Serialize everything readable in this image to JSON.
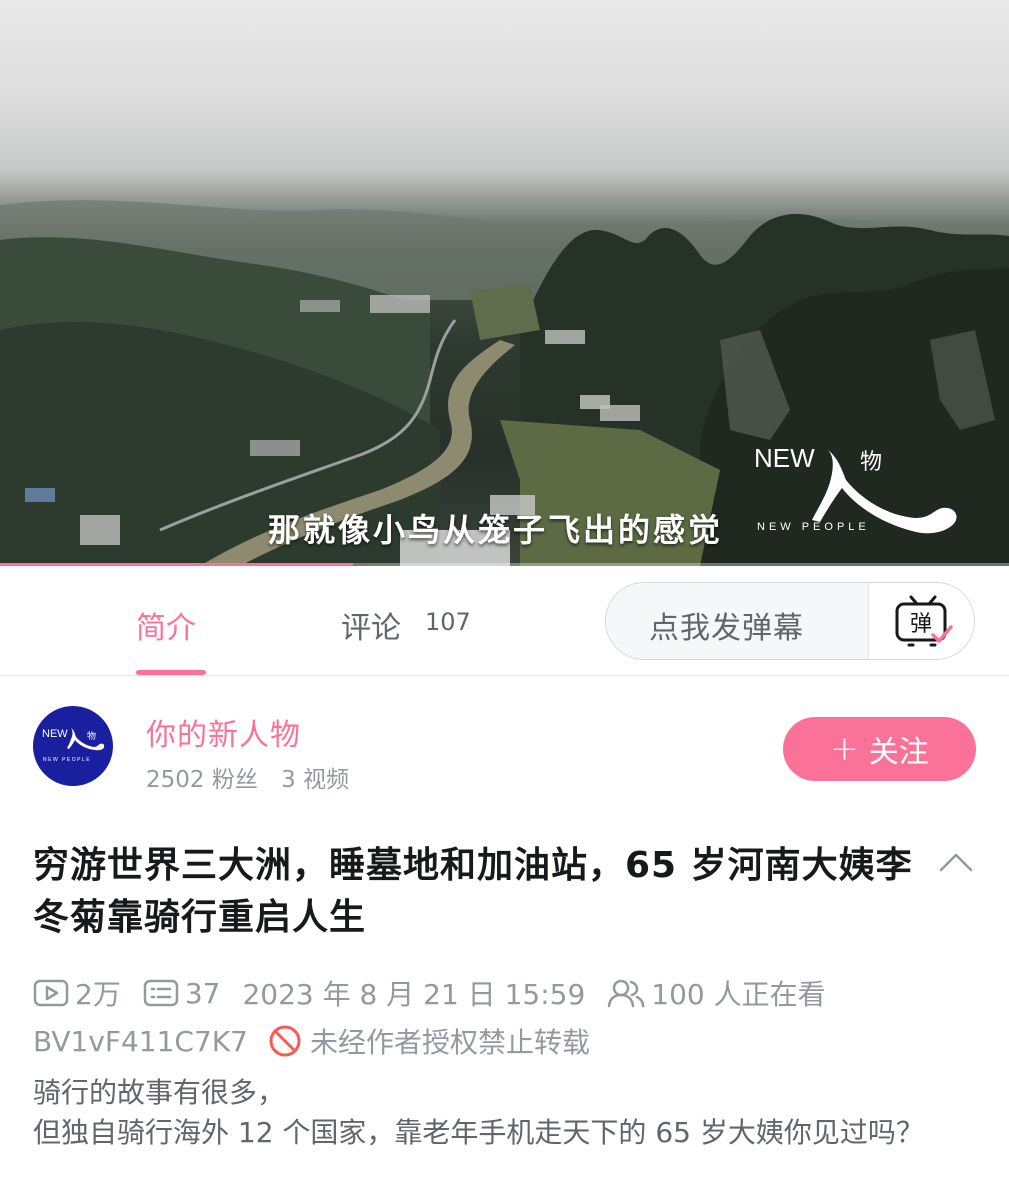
{
  "video": {
    "subtitle": "那就像小鸟从笼子飞出的感觉",
    "watermark": {
      "new": "NEW",
      "wu": "物",
      "people": "NEW PEOPLE"
    },
    "progress_fraction": 0.35,
    "accent_color": "#fb7299"
  },
  "tabs": {
    "intro_label": "简介",
    "comments_label": "评论",
    "comments_count": "107",
    "danmaku_placeholder": "点我发弹幕",
    "danmaku_icon_char": "弹"
  },
  "uploader": {
    "name": "你的新人物",
    "followers": "2502 粉丝",
    "videos": "3 视频",
    "avatar": {
      "new": "NEW",
      "wu": "物",
      "people": "NEW PEOPLE"
    },
    "follow_label": "关注",
    "follow_plus": "+"
  },
  "video_info": {
    "title": "穷游世界三大洲，睡墓地和加油站，65 岁河南大姨李冬菊靠骑行重启人生",
    "plays": "2万",
    "danmaku_count": "37",
    "datetime": "2023 年 8 月 21 日 15:59",
    "watching": "100 人正在看",
    "bvid": "BV1vF411C7K7",
    "no_repost": "未经作者授权禁止转载",
    "description_lines": [
      "骑行的故事有很多，",
      "但独自骑行海外 12 个国家，靠老年手机走天下的 65 岁大姨你见过吗？"
    ]
  }
}
